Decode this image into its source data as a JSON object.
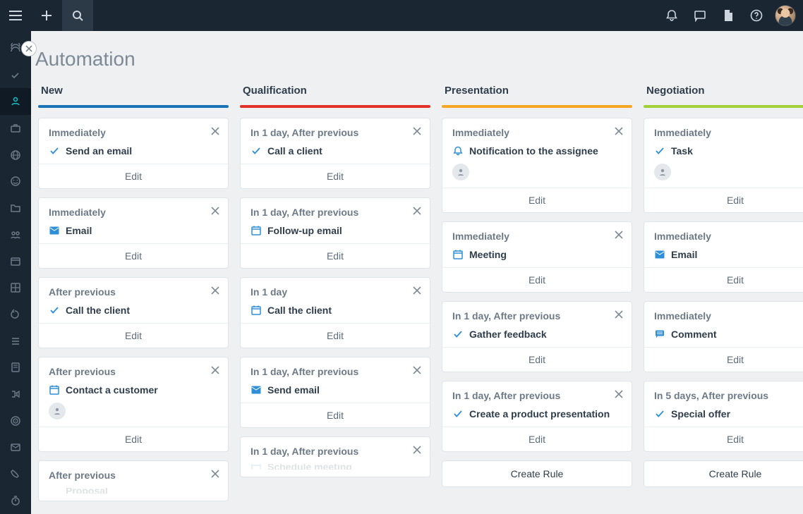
{
  "page_title": "Automation",
  "edit_label": "Edit",
  "create_rule_label": "Create Rule",
  "columns": [
    {
      "name": "New",
      "color": "blue",
      "cards": [
        {
          "trigger": "Immediately",
          "icon": "check",
          "action": "Send an email"
        },
        {
          "trigger": "Immediately",
          "icon": "mail",
          "action": "Email"
        },
        {
          "trigger": "After previous",
          "icon": "check",
          "action": "Call the client"
        },
        {
          "trigger": "After previous",
          "icon": "calendar",
          "action": "Contact a customer",
          "assignee": true
        },
        {
          "trigger": "After previous",
          "icon": "none",
          "action": "Proposal",
          "truncated": true
        }
      ],
      "show_create": false
    },
    {
      "name": "Qualification",
      "color": "red",
      "cards": [
        {
          "trigger": "In 1 day, After previous",
          "icon": "check",
          "action": "Call a client"
        },
        {
          "trigger": "In 1 day, After previous",
          "icon": "calendar",
          "action": "Follow-up email"
        },
        {
          "trigger": "In 1 day",
          "icon": "calendar",
          "action": "Call the client"
        },
        {
          "trigger": "In 1 day, After previous",
          "icon": "mail",
          "action": "Send email"
        },
        {
          "trigger": "In 1 day, After previous",
          "icon": "calendar",
          "action": "Schedule meeting",
          "truncated": true
        }
      ],
      "show_create": false
    },
    {
      "name": "Presentation",
      "color": "orange",
      "cards": [
        {
          "trigger": "Immediately",
          "icon": "bell",
          "action": "Notification to the assignee",
          "assignee": true
        },
        {
          "trigger": "Immediately",
          "icon": "calendar",
          "action": "Meeting"
        },
        {
          "trigger": "In 1 day, After previous",
          "icon": "check",
          "action": "Gather feedback"
        },
        {
          "trigger": "In 1 day, After previous",
          "icon": "check",
          "action": "Create a product presentation"
        }
      ],
      "show_create": true
    },
    {
      "name": "Negotiation",
      "color": "green",
      "cards": [
        {
          "trigger": "Immediately",
          "icon": "check",
          "action": "Task",
          "assignee": true
        },
        {
          "trigger": "Immediately",
          "icon": "mail",
          "action": "Email"
        },
        {
          "trigger": "Immediately",
          "icon": "comment",
          "action": "Comment"
        },
        {
          "trigger": "In 5 days, After previous",
          "icon": "check",
          "action": "Special offer"
        }
      ],
      "show_create": true
    }
  ],
  "sidebar_items": [
    "feed-icon",
    "check-icon",
    "contacts-icon",
    "briefcase-icon",
    "globe-icon",
    "smiley-icon",
    "folder-icon",
    "people-icon",
    "window-icon",
    "layout-icon",
    "loop-icon",
    "list-icon",
    "doc-icon",
    "flow-icon",
    "target-icon",
    "mail-icon",
    "phone-icon",
    "timer-icon"
  ]
}
